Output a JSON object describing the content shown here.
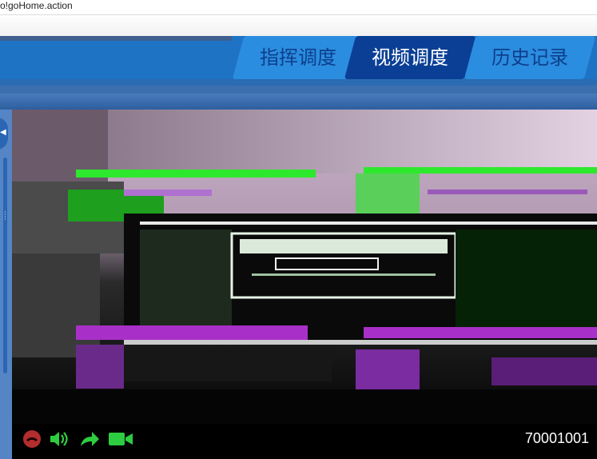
{
  "browser": {
    "address_fragment": "o!goHome.action"
  },
  "nav": {
    "tabs": [
      {
        "label": "指挥调度",
        "active": false
      },
      {
        "label": "视频调度",
        "active": true
      },
      {
        "label": "历史记录",
        "active": false
      }
    ]
  },
  "video": {
    "controls": [
      {
        "icon": "hangup-icon",
        "color": "#c0392b"
      },
      {
        "icon": "speaker-icon",
        "color": "#2ecc40"
      },
      {
        "icon": "forward-icon",
        "color": "#2ecc40"
      },
      {
        "icon": "video-camera-icon",
        "color": "#2ecc40"
      }
    ],
    "device_id": "70001001"
  },
  "colors": {
    "header": "#1e73c4",
    "active_tab": "#0a3f95",
    "inactive_tab": "#2b8de0"
  }
}
